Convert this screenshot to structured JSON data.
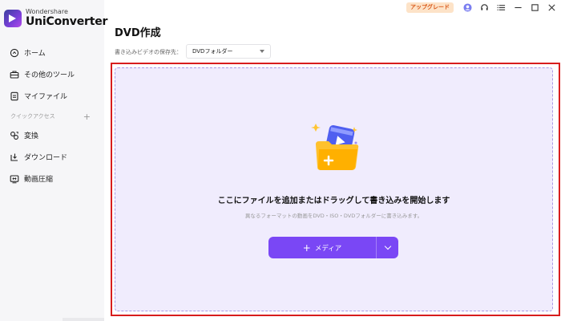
{
  "app": {
    "brand": "Wondershare",
    "product": "UniConverter"
  },
  "topbar": {
    "upgrade_label": "アップグレード"
  },
  "sidebar": {
    "items": [
      {
        "label": "ホーム",
        "icon": "home-icon"
      },
      {
        "label": "その他のツール",
        "icon": "toolbox-icon"
      },
      {
        "label": "マイファイル",
        "icon": "file-icon"
      }
    ],
    "quick_access_label": "クイックアクセス",
    "quick_access_add": "+",
    "quick_items": [
      {
        "label": "変換",
        "icon": "convert-icon"
      },
      {
        "label": "ダウンロード",
        "icon": "download-icon"
      },
      {
        "label": "動画圧縮",
        "icon": "compress-icon"
      }
    ]
  },
  "main": {
    "title": "DVD作成",
    "save_label": "書き込みビデオの保存先：",
    "save_select_value": "DVDフォルダー",
    "drop_title": "ここにファイルを追加またはドラッグして書き込みを開始します",
    "drop_subtitle": "異なるフォーマットの動画をDVD・ISO・DVDフォルダーに書き込みます。",
    "media_button_plus": "+",
    "media_button_label": "メディア"
  },
  "colors": {
    "accent": "#7a47f5",
    "dropzone_bg": "#f0ecfd",
    "highlight_frame": "#d81d1d",
    "upgrade_text": "#d9591a"
  }
}
